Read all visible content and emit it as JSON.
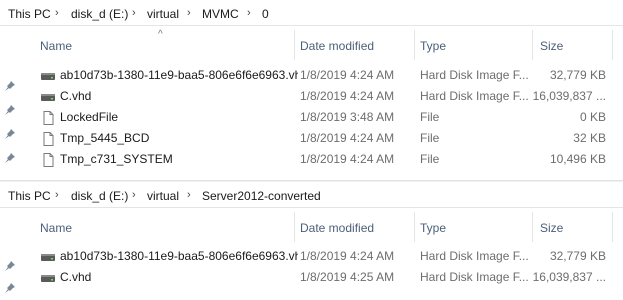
{
  "pane1": {
    "breadcrumb": [
      "This PC",
      "disk_d (E:)",
      "virtual",
      "MVMC",
      "0"
    ],
    "columns": {
      "name": "Name",
      "date": "Date modified",
      "type": "Type",
      "size": "Size"
    },
    "files": [
      {
        "name": "ab10d73b-1380-11e9-baa5-806e6f6e6963.vhd",
        "date": "1/8/2019 4:24 AM",
        "type": "Hard Disk Image F...",
        "size": "32,779 KB",
        "icon": "vhd-disk-icon"
      },
      {
        "name": "C.vhd",
        "date": "1/8/2019 4:24 AM",
        "type": "Hard Disk Image F...",
        "size": "16,039,837 ...",
        "icon": "vhd-disk-icon"
      },
      {
        "name": "LockedFile",
        "date": "1/8/2019 3:48 AM",
        "type": "File",
        "size": "0 KB",
        "icon": "file-icon"
      },
      {
        "name": "Tmp_5445_BCD",
        "date": "1/8/2019 4:24 AM",
        "type": "File",
        "size": "32 KB",
        "icon": "file-icon"
      },
      {
        "name": "Tmp_c731_SYSTEM",
        "date": "1/8/2019 4:24 AM",
        "type": "File",
        "size": "10,496 KB",
        "icon": "file-icon"
      }
    ]
  },
  "pane2": {
    "breadcrumb": [
      "This PC",
      "disk_d (E:)",
      "virtual",
      "Server2012-converted"
    ],
    "columns": {
      "name": "Name",
      "date": "Date modified",
      "type": "Type",
      "size": "Size"
    },
    "files": [
      {
        "name": "ab10d73b-1380-11e9-baa5-806e6f6e6963.vhd",
        "date": "1/8/2019 4:24 AM",
        "type": "Hard Disk Image F...",
        "size": "32,779 KB",
        "icon": "vhd-disk-icon"
      },
      {
        "name": "C.vhd",
        "date": "1/8/2019 4:25 AM",
        "type": "Hard Disk Image F...",
        "size": "16,039,837 ...",
        "icon": "vhd-disk-icon"
      }
    ]
  },
  "colors": {
    "header_text": "#4c607a",
    "meta_text": "#6d6d6d",
    "divider": "#e5e5e5"
  }
}
